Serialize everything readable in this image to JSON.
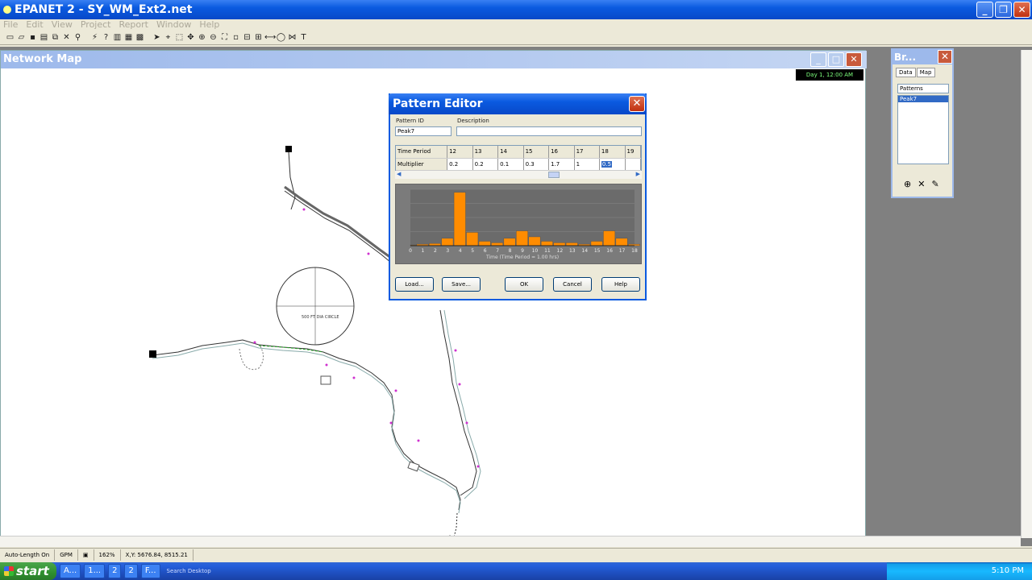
{
  "app": {
    "title": "EPANET 2 - SY_WM_Ext2.net",
    "menu": [
      "File",
      "Edit",
      "View",
      "Project",
      "Report",
      "Window",
      "Help"
    ]
  },
  "netmap": {
    "title": "Network Map",
    "time_badge": "Day 1, 12:00 AM",
    "circle_label": "500 FT DIA CIRCLE"
  },
  "browser": {
    "title": "Br...",
    "tabs": [
      "Data",
      "Map"
    ],
    "category": "Patterns",
    "items": [
      "Peak7"
    ]
  },
  "pattern_editor": {
    "title": "Pattern Editor",
    "pattern_id_label": "Pattern ID",
    "pattern_id": "Peak7",
    "description_label": "Description",
    "description": "",
    "time_period_label": "Time Period",
    "multiplier_label": "Multiplier",
    "periods": [
      "12",
      "13",
      "14",
      "15",
      "16",
      "17",
      "18",
      "19"
    ],
    "multipliers": [
      "0.2",
      "0.2",
      "0.1",
      "0.3",
      "1.7",
      "1",
      "0.5",
      ""
    ],
    "buttons": {
      "load": "Load...",
      "save": "Save...",
      "ok": "OK",
      "cancel": "Cancel",
      "help": "Help"
    }
  },
  "chart_data": {
    "type": "bar",
    "categories": [
      "0",
      "1",
      "2",
      "3",
      "4",
      "5",
      "6",
      "7",
      "8",
      "9",
      "10",
      "11",
      "12",
      "13",
      "14",
      "15",
      "16",
      "17",
      "18"
    ],
    "values": [
      0.05,
      0.1,
      0.15,
      0.5,
      3.6,
      0.9,
      0.3,
      0.2,
      0.5,
      1.0,
      0.6,
      0.3,
      0.2,
      0.2,
      0.1,
      0.3,
      1.0,
      0.5,
      0.1
    ],
    "xlabel": "Time (Time Period = 1.00 hrs)",
    "ylim": [
      0,
      3.8
    ],
    "bar_color": "#ff8c00"
  },
  "statusbar": {
    "auto_length": "Auto-Length On",
    "units": "GPM",
    "zoom": "162%",
    "xy": "X,Y: 5676.84, 8515.21"
  },
  "taskbar": {
    "start": "start",
    "tasks": [
      "A...",
      "1...",
      "2",
      "2",
      "F..."
    ],
    "search": "Search Desktop",
    "clock": "5:10 PM"
  }
}
